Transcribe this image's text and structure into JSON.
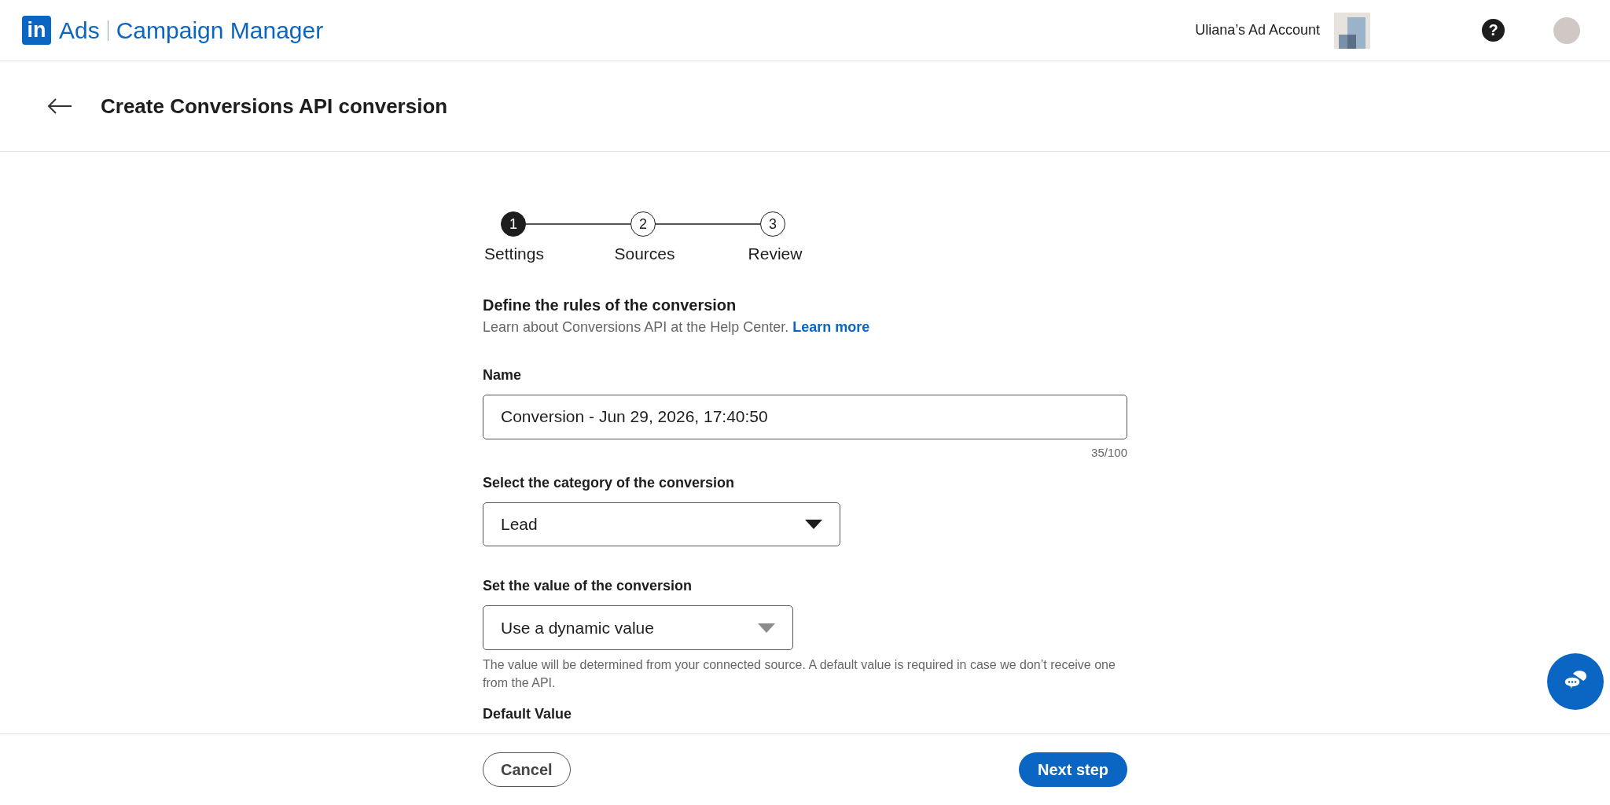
{
  "header": {
    "logo_mark": "in",
    "product": "Ads",
    "app_name": "Campaign Manager",
    "account_name": "Uliana’s Ad Account",
    "help": "?"
  },
  "page": {
    "title": "Create Conversions API conversion"
  },
  "steps": [
    {
      "number": "1",
      "label": "Settings",
      "selected": true
    },
    {
      "number": "2",
      "label": "Sources",
      "selected": false
    },
    {
      "number": "3",
      "label": "Review",
      "selected": false
    }
  ],
  "section": {
    "heading": "Define the rules of the conversion",
    "description": "Learn about Conversions API at the Help Center.",
    "link": "Learn more"
  },
  "fields": [
    {
      "kind": "text",
      "label": "Name",
      "value": "Conversion - Jun 29, 2026, 17:40:50",
      "counter": "35/100"
    },
    {
      "kind": "select",
      "label": "Select the category of the conversion",
      "value": "Lead",
      "disabled": false
    },
    {
      "kind": "select",
      "label": "Set the value of the conversion",
      "value": "Use a dynamic value",
      "disabled": true,
      "help": "The value will be determined from your connected source. A default value is required in case we don’t receive one from the API."
    },
    {
      "kind": "label",
      "label": "Default Value"
    }
  ],
  "footer": {
    "cancel": "Cancel",
    "next": "Next step"
  }
}
